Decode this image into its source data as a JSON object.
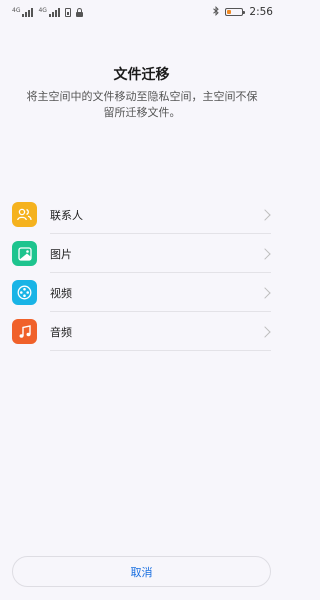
{
  "status_bar": {
    "signal_tag_1": "4G",
    "signal_tag_2": "4G",
    "time": "2:56",
    "battery_level": 0.25,
    "icons": [
      "signal-icon",
      "signal-icon",
      "sim-icon",
      "lock-icon",
      "bluetooth-icon",
      "battery-icon"
    ]
  },
  "header": {
    "title": "文件迁移",
    "description": "将主空间中的文件移动至隐私空间，主空间不保留所迁移文件。"
  },
  "list": {
    "items": [
      {
        "label": "联系人",
        "icon": "contacts-icon",
        "color": "#f5b21e"
      },
      {
        "label": "图片",
        "icon": "image-icon",
        "color": "#1ec48e"
      },
      {
        "label": "视频",
        "icon": "video-icon",
        "color": "#19b4e6"
      },
      {
        "label": "音频",
        "icon": "music-icon",
        "color": "#f0612a"
      }
    ]
  },
  "footer": {
    "cancel_label": "取消",
    "accent": "#1a6fe0"
  }
}
